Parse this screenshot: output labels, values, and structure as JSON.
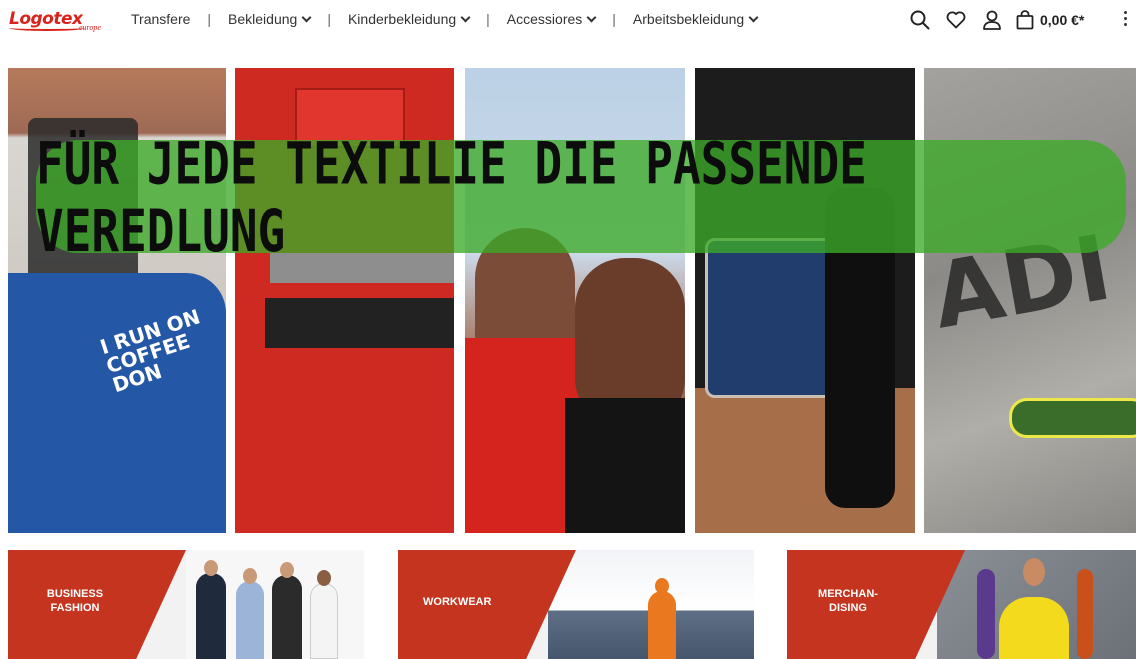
{
  "header": {
    "logo_text": "Logotex",
    "logo_subtext": "europe",
    "nav": [
      {
        "label": "Transfere",
        "has_dropdown": false
      },
      {
        "label": "Bekleidung",
        "has_dropdown": true
      },
      {
        "label": "Kinderbekleidung",
        "has_dropdown": true
      },
      {
        "label": "Accessiores",
        "has_dropdown": true
      },
      {
        "label": "Arbeitsbekleidung",
        "has_dropdown": true
      }
    ],
    "separator": "|",
    "icons": [
      "search-icon",
      "heart-icon",
      "user-icon",
      "shopping-bag-icon",
      "more-vertical-icon"
    ],
    "cart_amount": "0,00 €*"
  },
  "hero": {
    "headline": "FÜR JEDE TEXTILIE DIE PASSENDE VEREDLUNG",
    "banner_color": "#3caa28",
    "shirt_print": "I RUN ON COFFEE DON",
    "graffiti_text": "ADI"
  },
  "categories": [
    {
      "label": "BUSINESS FASHION",
      "color": "#c5341e"
    },
    {
      "label": "WORKWEAR",
      "color": "#c5341e"
    },
    {
      "label": "MERCHAN-DISING",
      "color": "#c5341e"
    }
  ],
  "colors": {
    "brand_red": "#d9221a",
    "text": "#333333"
  }
}
